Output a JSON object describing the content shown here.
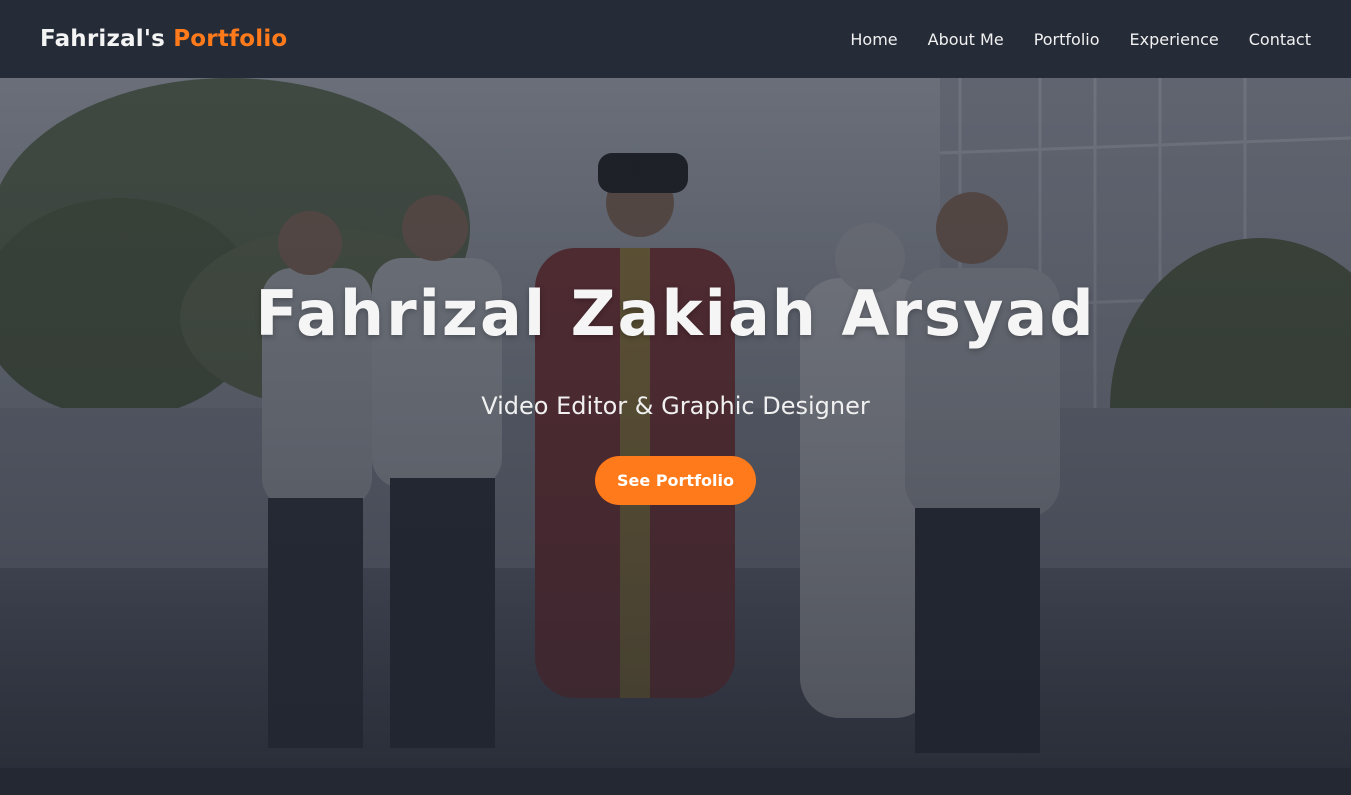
{
  "navbar": {
    "brand_name": "Fahrizal's",
    "brand_accent": "Portfolio",
    "links": [
      {
        "label": "Home"
      },
      {
        "label": "About Me"
      },
      {
        "label": "Portfolio"
      },
      {
        "label": "Experience"
      },
      {
        "label": "Contact"
      }
    ]
  },
  "hero": {
    "title": "Fahrizal Zakiah Arsyad",
    "subtitle": "Video Editor & Graphic Designer",
    "cta_label": "See Portfolio",
    "photo_description": ""
  },
  "colors": {
    "accent": "#ff7a1a",
    "navbar_bg": "#252b37",
    "page_bg": "#222733",
    "text_light": "#f4f4f4"
  }
}
